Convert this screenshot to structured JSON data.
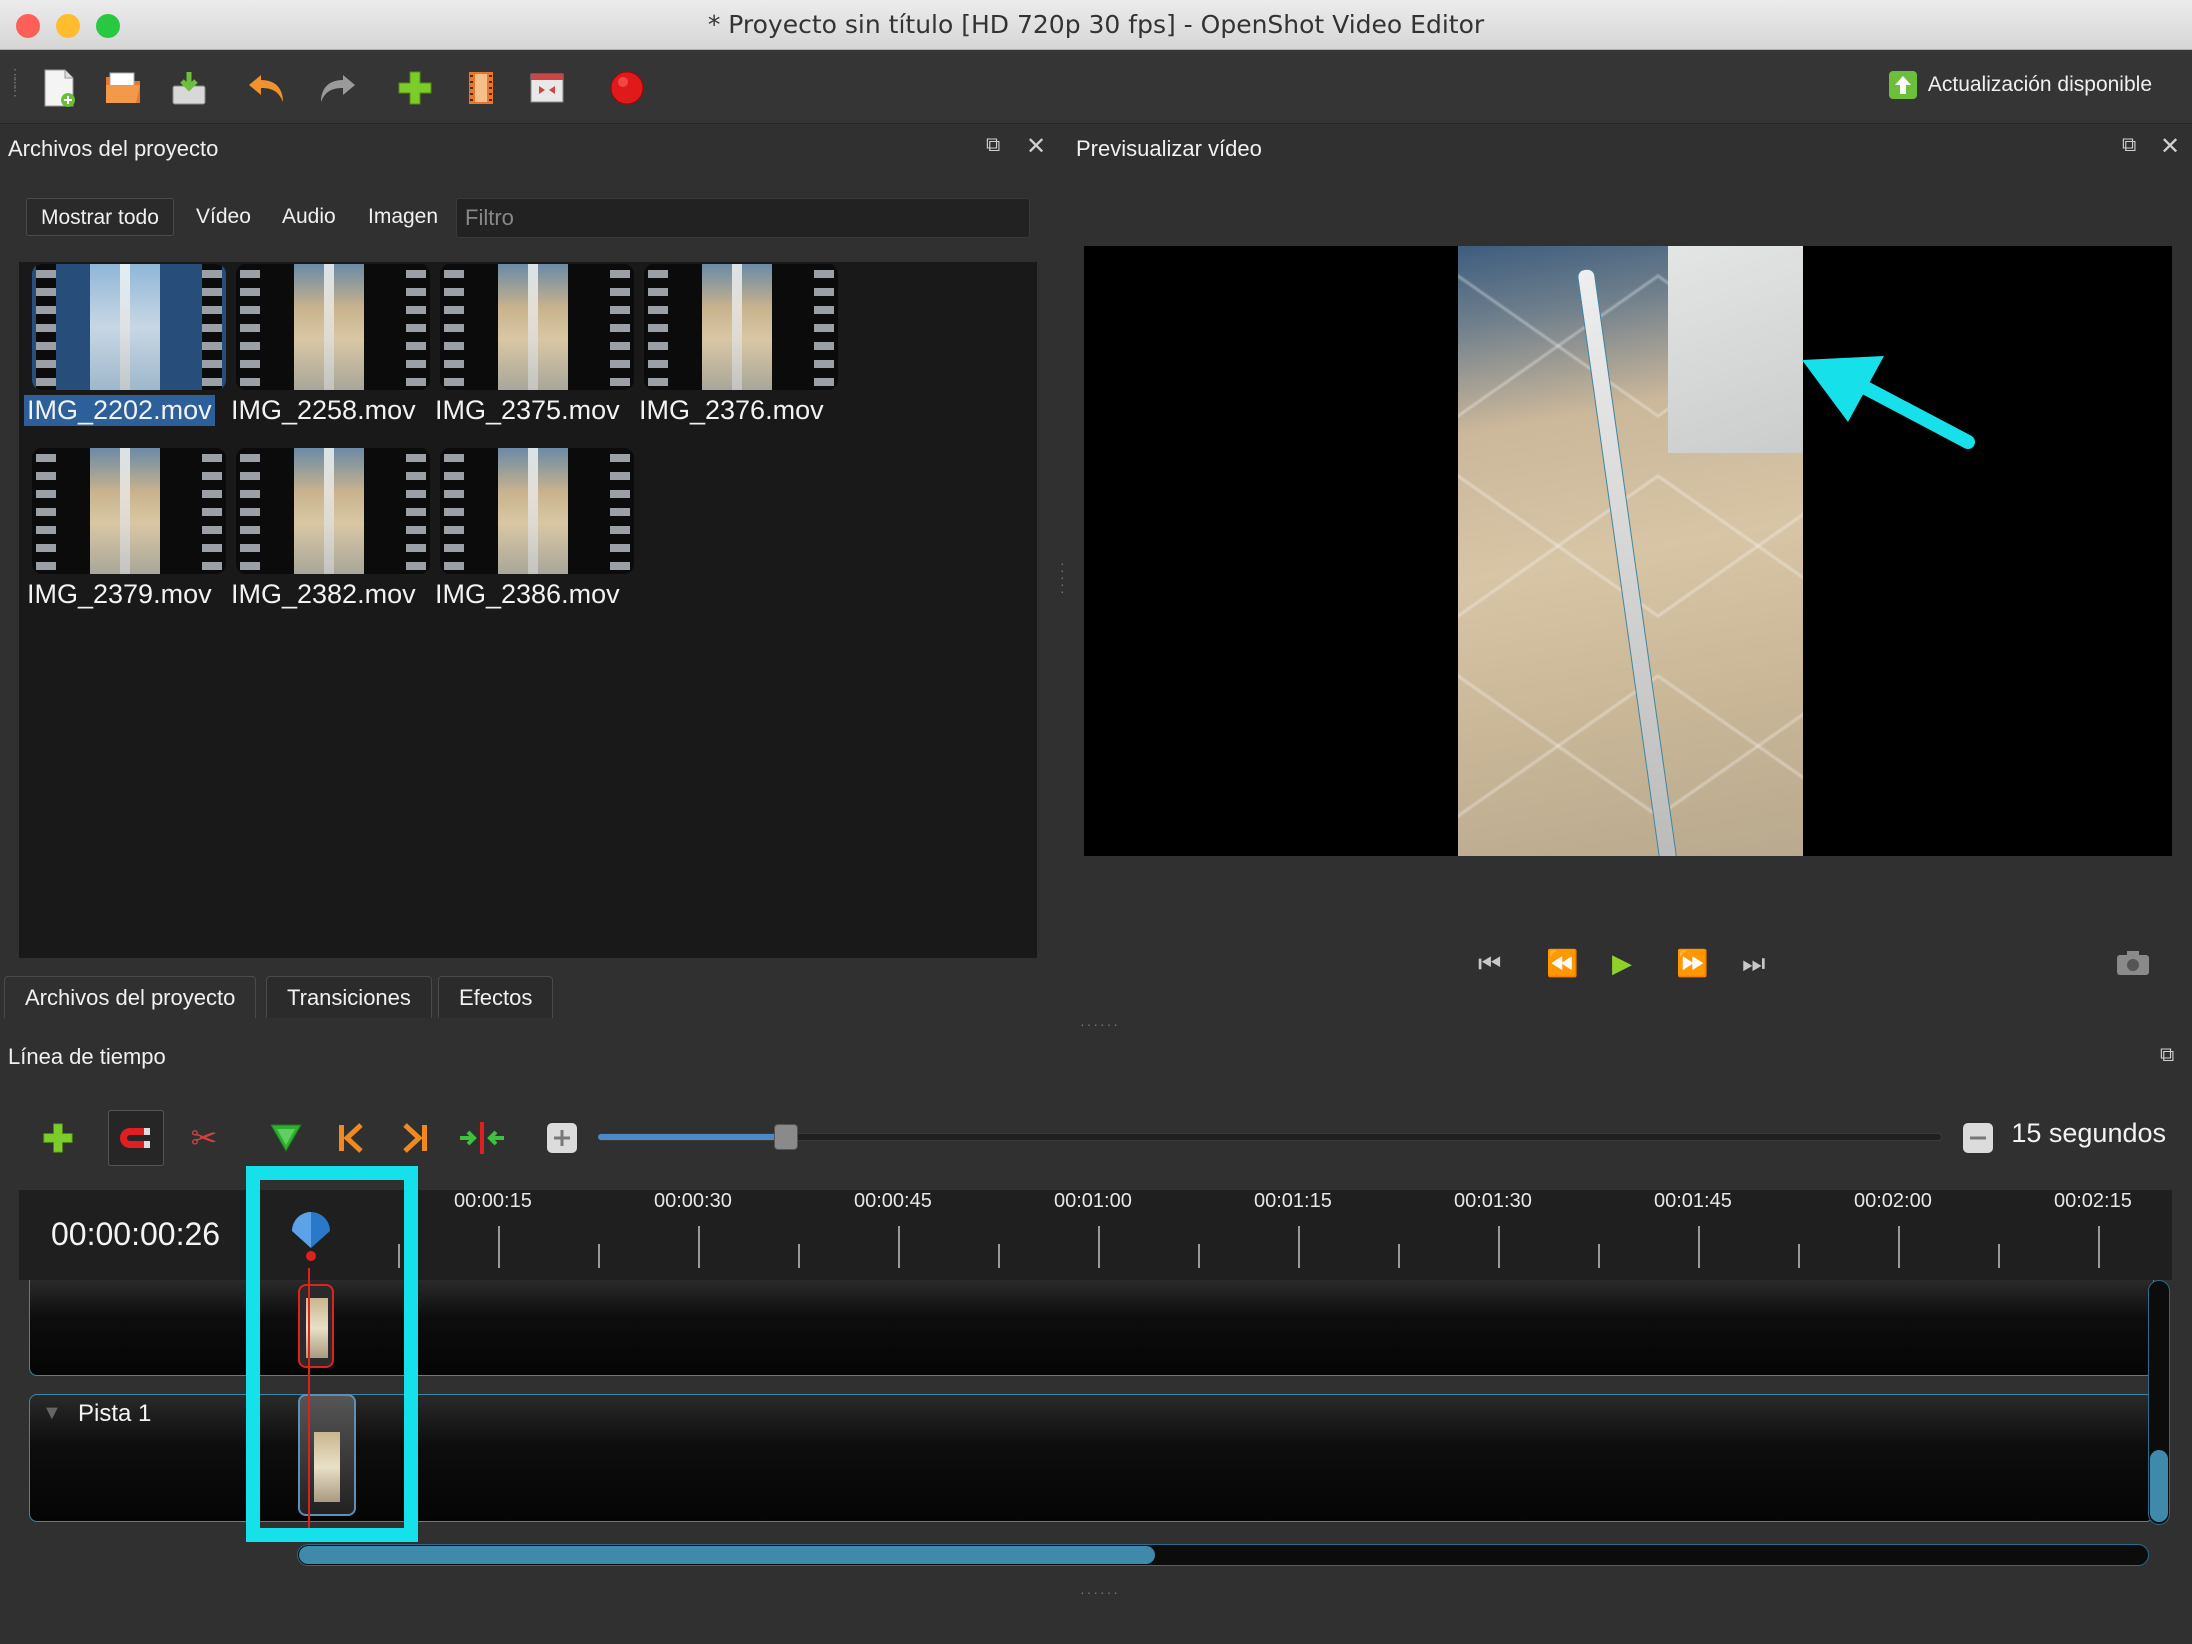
{
  "window": {
    "title": "* Proyecto sin título [HD 720p 30 fps] - OpenShot Video Editor",
    "traffic_lights": {
      "close": "#fe5f57",
      "minimize": "#febc2e",
      "zoom": "#28c840"
    }
  },
  "toolbar": {
    "buttons": [
      {
        "name": "new-project-icon"
      },
      {
        "name": "open-project-icon"
      },
      {
        "name": "save-project-icon"
      },
      {
        "name": "undo-icon"
      },
      {
        "name": "redo-icon"
      },
      {
        "name": "import-files-icon"
      },
      {
        "name": "choose-profile-icon"
      },
      {
        "name": "fullscreen-icon"
      },
      {
        "name": "export-video-icon"
      }
    ],
    "update_label": "Actualización disponible"
  },
  "project_files": {
    "title": "Archivos del proyecto",
    "filters": [
      "Mostrar todo",
      "Vídeo",
      "Audio",
      "Imagen"
    ],
    "filter_placeholder": "Filtro",
    "files": [
      {
        "name": "IMG_2202.mov",
        "selected": true
      },
      {
        "name": "IMG_2258.mov",
        "selected": false
      },
      {
        "name": "IMG_2375.mov",
        "selected": false
      },
      {
        "name": "IMG_2376.mov",
        "selected": false
      },
      {
        "name": "IMG_2379.mov",
        "selected": false
      },
      {
        "name": "IMG_2382.mov",
        "selected": false
      },
      {
        "name": "IMG_2386.mov",
        "selected": false
      }
    ],
    "tabs": [
      "Archivos del proyecto",
      "Transiciones",
      "Efectos"
    ]
  },
  "preview": {
    "title": "Previsualizar vídeo",
    "controls": [
      "jump-start-icon",
      "rewind-icon",
      "play-icon",
      "fast-forward-icon",
      "jump-end-icon"
    ],
    "snapshot_icon": "camera-icon"
  },
  "timeline": {
    "title": "Línea de tiempo",
    "tools": [
      "add-track-icon",
      "snap-magnet-icon",
      "razor-icon",
      "add-marker-icon",
      "previous-marker-icon",
      "next-marker-icon",
      "center-playhead-icon"
    ],
    "zoom_label": "15 segundos",
    "zoom_level": 0.1,
    "timecode": "00:00:00:26",
    "ruler_labels": [
      "00:00:15",
      "00:00:30",
      "00:00:45",
      "00:01:00",
      "00:01:15",
      "00:01:30",
      "00:01:45",
      "00:02:00",
      "00:02:15"
    ],
    "tracks": [
      {
        "name": ""
      },
      {
        "name": "Pista 1"
      }
    ]
  },
  "annotations": {
    "highlight_color": "#16e1ea"
  }
}
